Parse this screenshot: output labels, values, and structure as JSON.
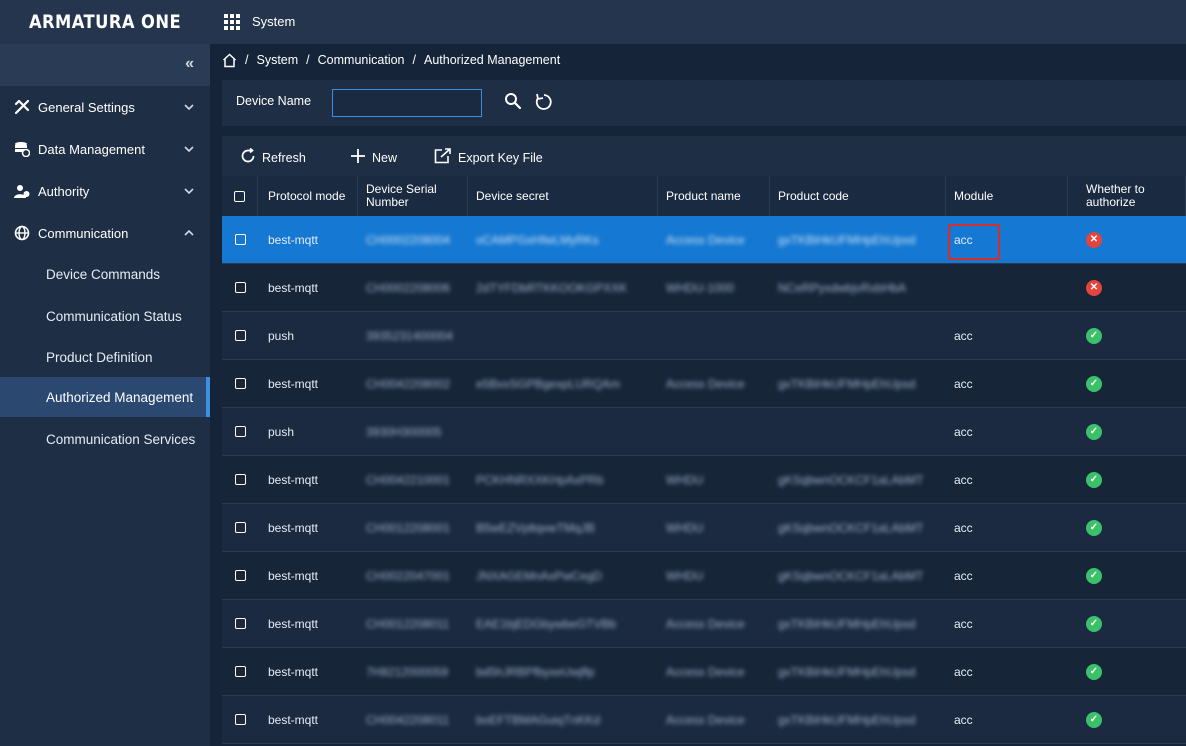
{
  "app": {
    "logo": "ARMATURA ONE",
    "name": "System"
  },
  "sidebar": {
    "collapse_icon": "«",
    "groups": [
      {
        "label": "General Settings",
        "icon": "tools-icon",
        "expanded": false
      },
      {
        "label": "Data Management",
        "icon": "database-icon",
        "expanded": false
      },
      {
        "label": "Authority",
        "icon": "users-icon",
        "expanded": false
      },
      {
        "label": "Communication",
        "icon": "globe-icon",
        "expanded": true
      }
    ],
    "sub_items": [
      {
        "label": "Device Commands"
      },
      {
        "label": "Communication Status"
      },
      {
        "label": "Product Definition"
      },
      {
        "label": "Authorized Management",
        "active": true
      },
      {
        "label": "Communication Services"
      }
    ]
  },
  "breadcrumb": [
    "System",
    "Communication",
    "Authorized Management"
  ],
  "breadcrumb_sep": "/",
  "search": {
    "label": "Device Name",
    "value": ""
  },
  "toolbar": {
    "refresh": "Refresh",
    "new": "New",
    "export": "Export Key File"
  },
  "table": {
    "columns": [
      "Protocol mode",
      "Device Serial Number",
      "Device secret",
      "Product name",
      "Product code",
      "Module",
      "Whether to authorize"
    ],
    "rows": [
      {
        "protocol": "best-mqtt",
        "serial": "CH0002208004",
        "secret": "oCAMPGxHfwLMyRKs",
        "pname": "Access Device",
        "pcode": "gxTKBiHkUFMHpEhUpsd",
        "module": "acc",
        "authorized": false,
        "selected": true,
        "highlight": true
      },
      {
        "protocol": "best-mqtt",
        "serial": "CH0002208006",
        "secret": "2dTYFDbRTKKOOKGPXXK",
        "pname": "WHDU-1000",
        "pcode": "NCeRPyxdwbjvRxbHbA",
        "module": "",
        "authorized": false
      },
      {
        "protocol": "push",
        "serial": "3935231400004",
        "secret": "",
        "pname": "",
        "pcode": "",
        "module": "acc",
        "authorized": true
      },
      {
        "protocol": "best-mqtt",
        "serial": "CH0042208002",
        "secret": "e5BxxSGPBgexpLURQAm",
        "pname": "Access Device",
        "pcode": "gxTKBiHkUFMHpEhUpsd",
        "module": "acc",
        "authorized": true
      },
      {
        "protocol": "push",
        "serial": "3930H300005",
        "secret": "",
        "pname": "",
        "pcode": "",
        "module": "acc",
        "authorized": true
      },
      {
        "protocol": "best-mqtt",
        "serial": "CH0042210001",
        "secret": "PCKHNRXXKHpAxPRb",
        "pname": "WHDU",
        "pcode": "gKSqbwnOCKCF1aLAbMT",
        "module": "acc",
        "authorized": true
      },
      {
        "protocol": "best-mqtt",
        "serial": "CH0012208001",
        "secret": "B5wEZVpltqvwTMqJB",
        "pname": "WHDU",
        "pcode": "gKSqbwnOCKCF1aLAbMT",
        "module": "acc",
        "authorized": true
      },
      {
        "protocol": "best-mqtt",
        "serial": "CH0022047001",
        "secret": "JNXAGEMnAxPwCegD",
        "pname": "WHDU",
        "pcode": "gKSqbwnOCKCF1aLAbMT",
        "module": "acc",
        "authorized": true
      },
      {
        "protocol": "best-mqtt",
        "serial": "CH0012208011",
        "secret": "EAE1bjEDGbywbeGTVBb",
        "pname": "Access Device",
        "pcode": "gxTKBiHkUFMHpEhUpsd",
        "module": "acc",
        "authorized": true
      },
      {
        "protocol": "best-mqtt",
        "serial": "7H8212000059",
        "secret": "bd5hJRBPfbyxeUwjflp",
        "pname": "Access Device",
        "pcode": "gxTKBiHkUFMHpEhUpsd",
        "module": "acc",
        "authorized": true
      },
      {
        "protocol": "best-mqtt",
        "serial": "CH0042208011",
        "secret": "boEFTBMAGuiqTnKKd",
        "pname": "Access Device",
        "pcode": "gxTKBiHkUFMHpEhUpsd",
        "module": "acc",
        "authorized": true
      }
    ]
  }
}
